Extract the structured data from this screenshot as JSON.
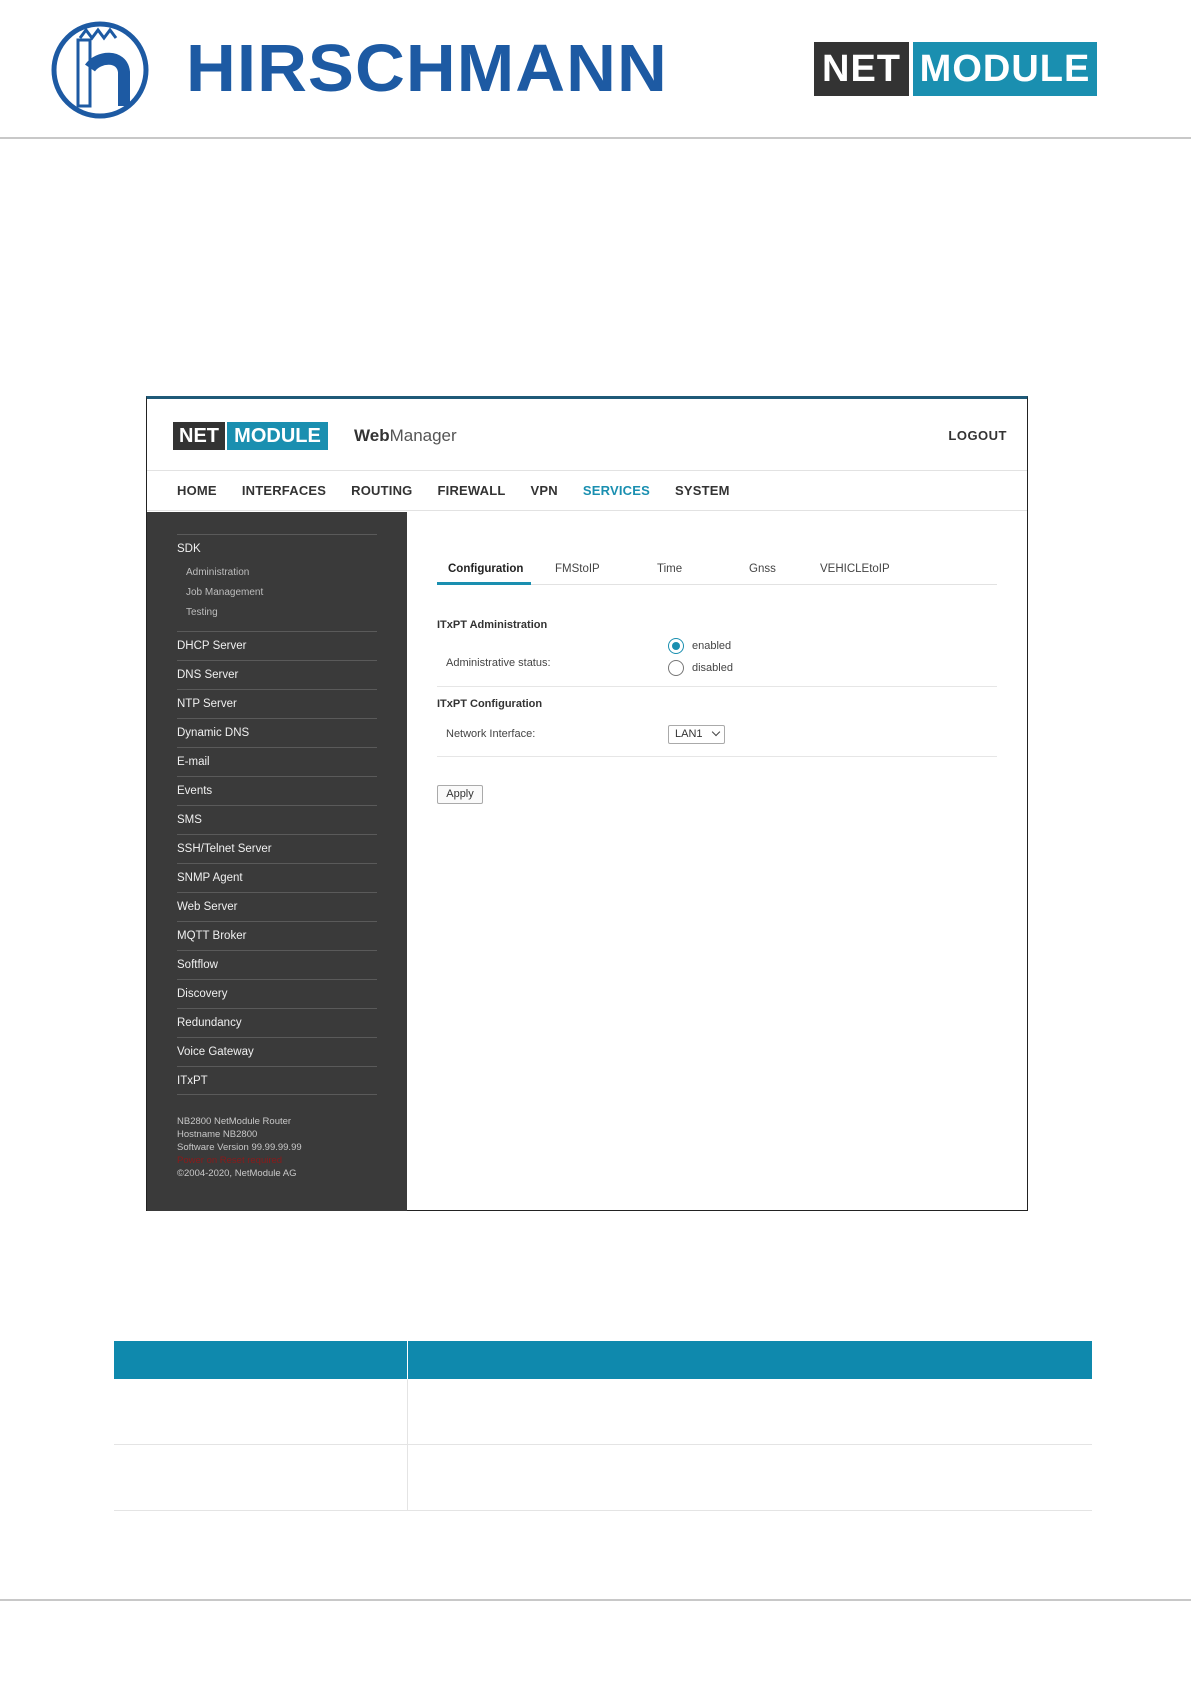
{
  "header": {
    "brand_left": "HIRSCHMANN",
    "brand_right_net": "NET",
    "brand_right_module": "MODULE"
  },
  "app": {
    "logo_net": "NET",
    "logo_module": "MODULE",
    "title_bold": "Web",
    "title_light": "Manager",
    "logout": "LOGOUT"
  },
  "nav": {
    "items": [
      "HOME",
      "INTERFACES",
      "ROUTING",
      "FIREWALL",
      "VPN",
      "SERVICES",
      "SYSTEM"
    ],
    "active": "SERVICES"
  },
  "sidebar": {
    "sdk": "SDK",
    "sdk_sub": [
      "Administration",
      "Job Management",
      "Testing"
    ],
    "items": [
      "DHCP Server",
      "DNS Server",
      "NTP Server",
      "Dynamic DNS",
      "E-mail",
      "Events",
      "SMS",
      "SSH/Telnet Server",
      "SNMP Agent",
      "Web Server",
      "MQTT Broker",
      "Softflow",
      "Discovery",
      "Redundancy",
      "Voice Gateway",
      "ITxPT"
    ],
    "footer": [
      "NB2800 NetModule Router",
      "Hostname NB2800",
      "Software Version 99.99.99.99",
      "Power on Reset required",
      "©2004-2020, NetModule AG"
    ]
  },
  "tabs": [
    "Configuration",
    "FMStoIP",
    "Time",
    "Gnss",
    "VEHICLEtoIP"
  ],
  "active_tab": "Configuration",
  "admin": {
    "section_title": "ITxPT Administration",
    "status_label": "Administrative status:",
    "option_enabled": "enabled",
    "option_disabled": "disabled",
    "selected": "enabled"
  },
  "config": {
    "section_title": "ITxPT Configuration",
    "interface_label": "Network Interface:",
    "interface_value": "LAN1"
  },
  "apply_label": "Apply",
  "colors": {
    "accent": "#1a8fb0",
    "brand_blue": "#1d5aa3",
    "sidebar_bg": "#3a3a3a",
    "table_header": "#0f89ad"
  }
}
